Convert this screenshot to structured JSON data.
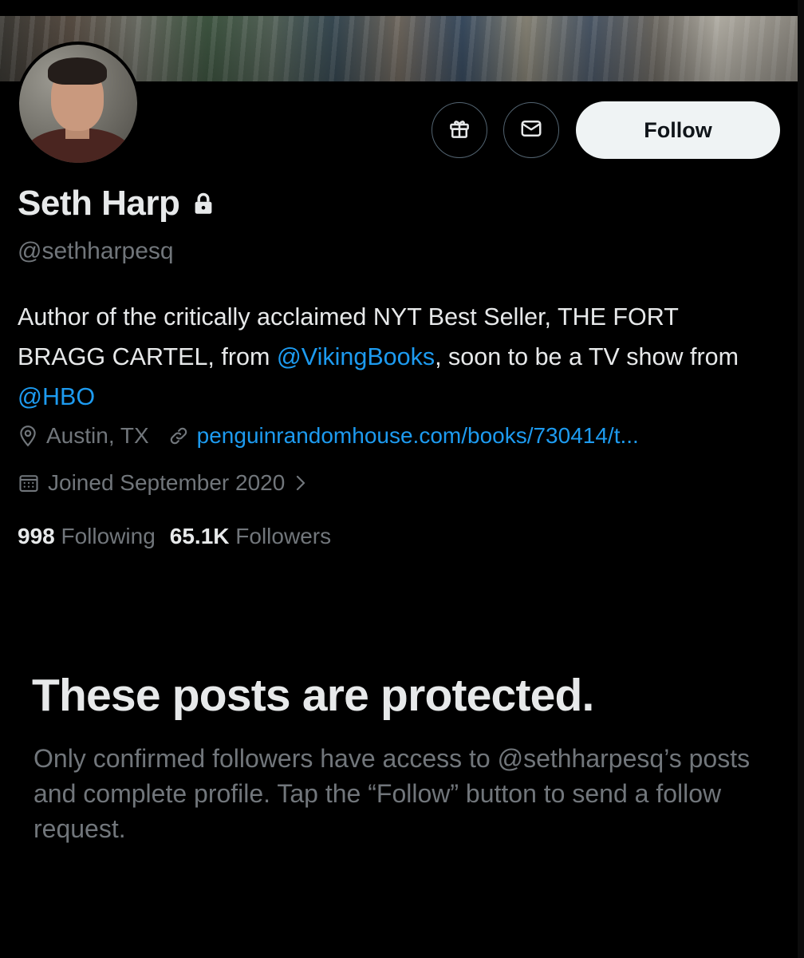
{
  "profile": {
    "display_name": "Seth Harp",
    "handle": "@sethharpesq",
    "bio": {
      "part1": "Author of the critically acclaimed NYT Best Seller, THE FORT BRAGG CARTEL, from ",
      "mention1": "@VikingBooks",
      "part2": ", soon to be a TV show from ",
      "mention2": "@HBO"
    },
    "location": "Austin, TX",
    "website": "penguinrandomhouse.com/books/730414/t...",
    "joined": "Joined September 2020",
    "following_count": "998",
    "following_label": "Following",
    "followers_count": "65.1K",
    "followers_label": "Followers"
  },
  "actions": {
    "follow_label": "Follow"
  },
  "protected_notice": {
    "title": "These posts are protected.",
    "body": "Only confirmed followers have access to @sethharpesq’s posts and complete profile. Tap the “Follow” button to send a follow request."
  },
  "icons": {
    "gift": "gift-icon",
    "message": "envelope-icon",
    "lock": "lock-icon",
    "location": "location-pin-icon",
    "link": "link-icon",
    "calendar": "calendar-icon",
    "chevron": "chevron-right-icon"
  },
  "colors": {
    "background": "#000000",
    "text_primary": "#e7e9ea",
    "text_secondary": "#71767b",
    "accent_link": "#1d9bf0",
    "follow_button_bg": "#eff3f4"
  }
}
